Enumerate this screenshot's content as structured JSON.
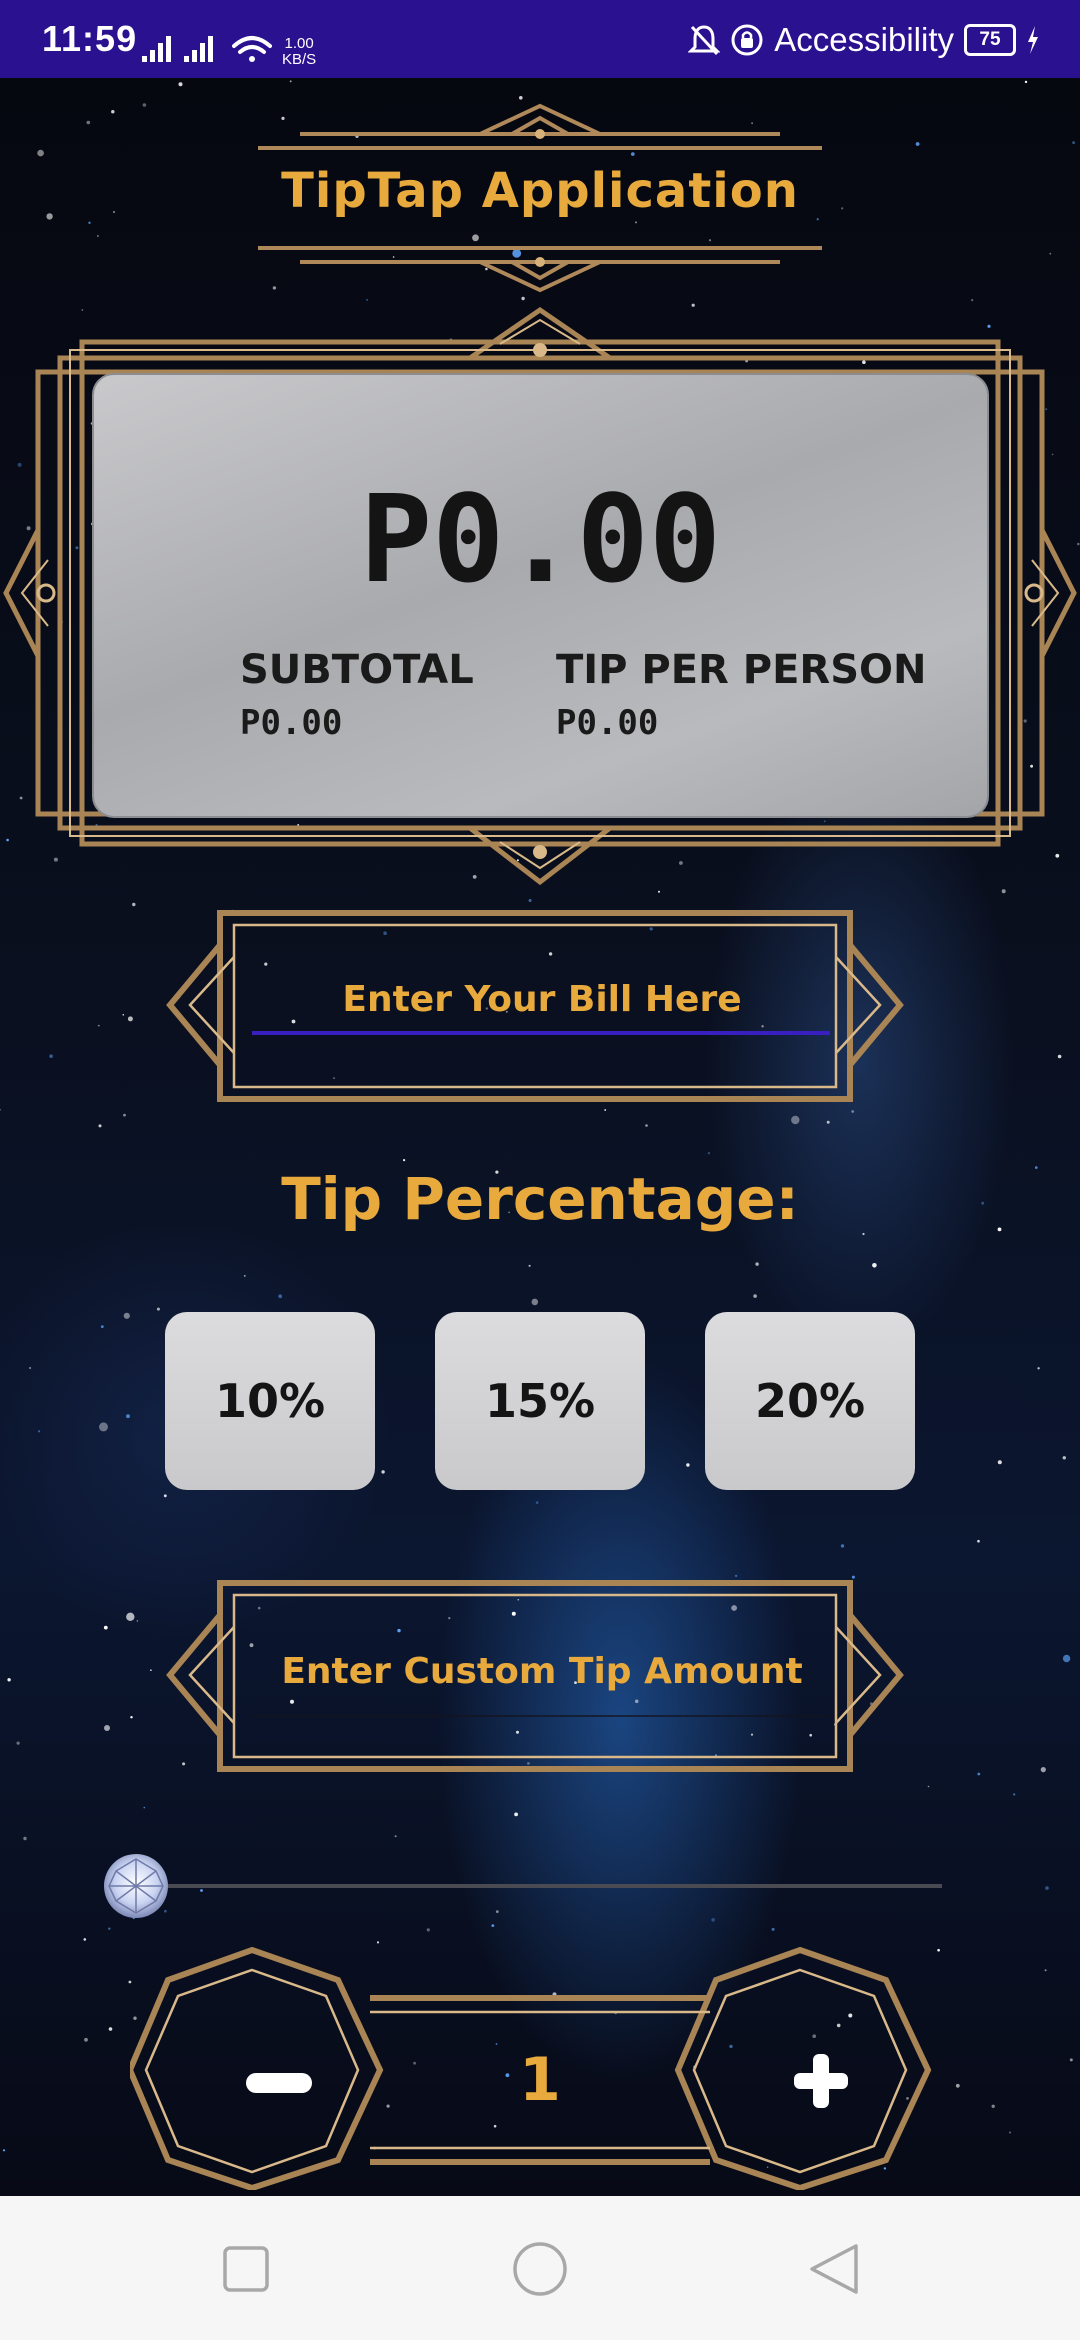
{
  "status_bar": {
    "time": "11:59",
    "net_speed_value": "1.00",
    "net_speed_unit": "KB/S",
    "accessibility_label": "Accessibility",
    "battery_level": "75"
  },
  "app": {
    "title": "TipTap Application"
  },
  "result_card": {
    "total": "P0.00",
    "subtotal_label": "SUBTOTAL",
    "subtotal_value": "P0.00",
    "tip_per_person_label": "TIP PER PERSON",
    "tip_per_person_value": "P0.00"
  },
  "bill_input": {
    "placeholder": "Enter Your Bill Here",
    "value": ""
  },
  "tip_section": {
    "heading": "Tip Percentage:",
    "options": [
      "10%",
      "15%",
      "20%"
    ]
  },
  "custom_tip_input": {
    "placeholder": "Enter Custom Tip Amount",
    "value": ""
  },
  "tip_slider": {
    "value": 0
  },
  "party_stepper": {
    "count": "1",
    "decrement_icon": "minus-icon",
    "increment_icon": "plus-icon"
  },
  "theme": {
    "accent": "#e8a93d",
    "status_bar": "#2a118f",
    "underline": "#3a1fc0",
    "card": "#b5b6b9"
  },
  "navbar": {
    "icons": [
      "recents-square-icon",
      "home-circle-icon",
      "back-triangle-icon"
    ]
  }
}
